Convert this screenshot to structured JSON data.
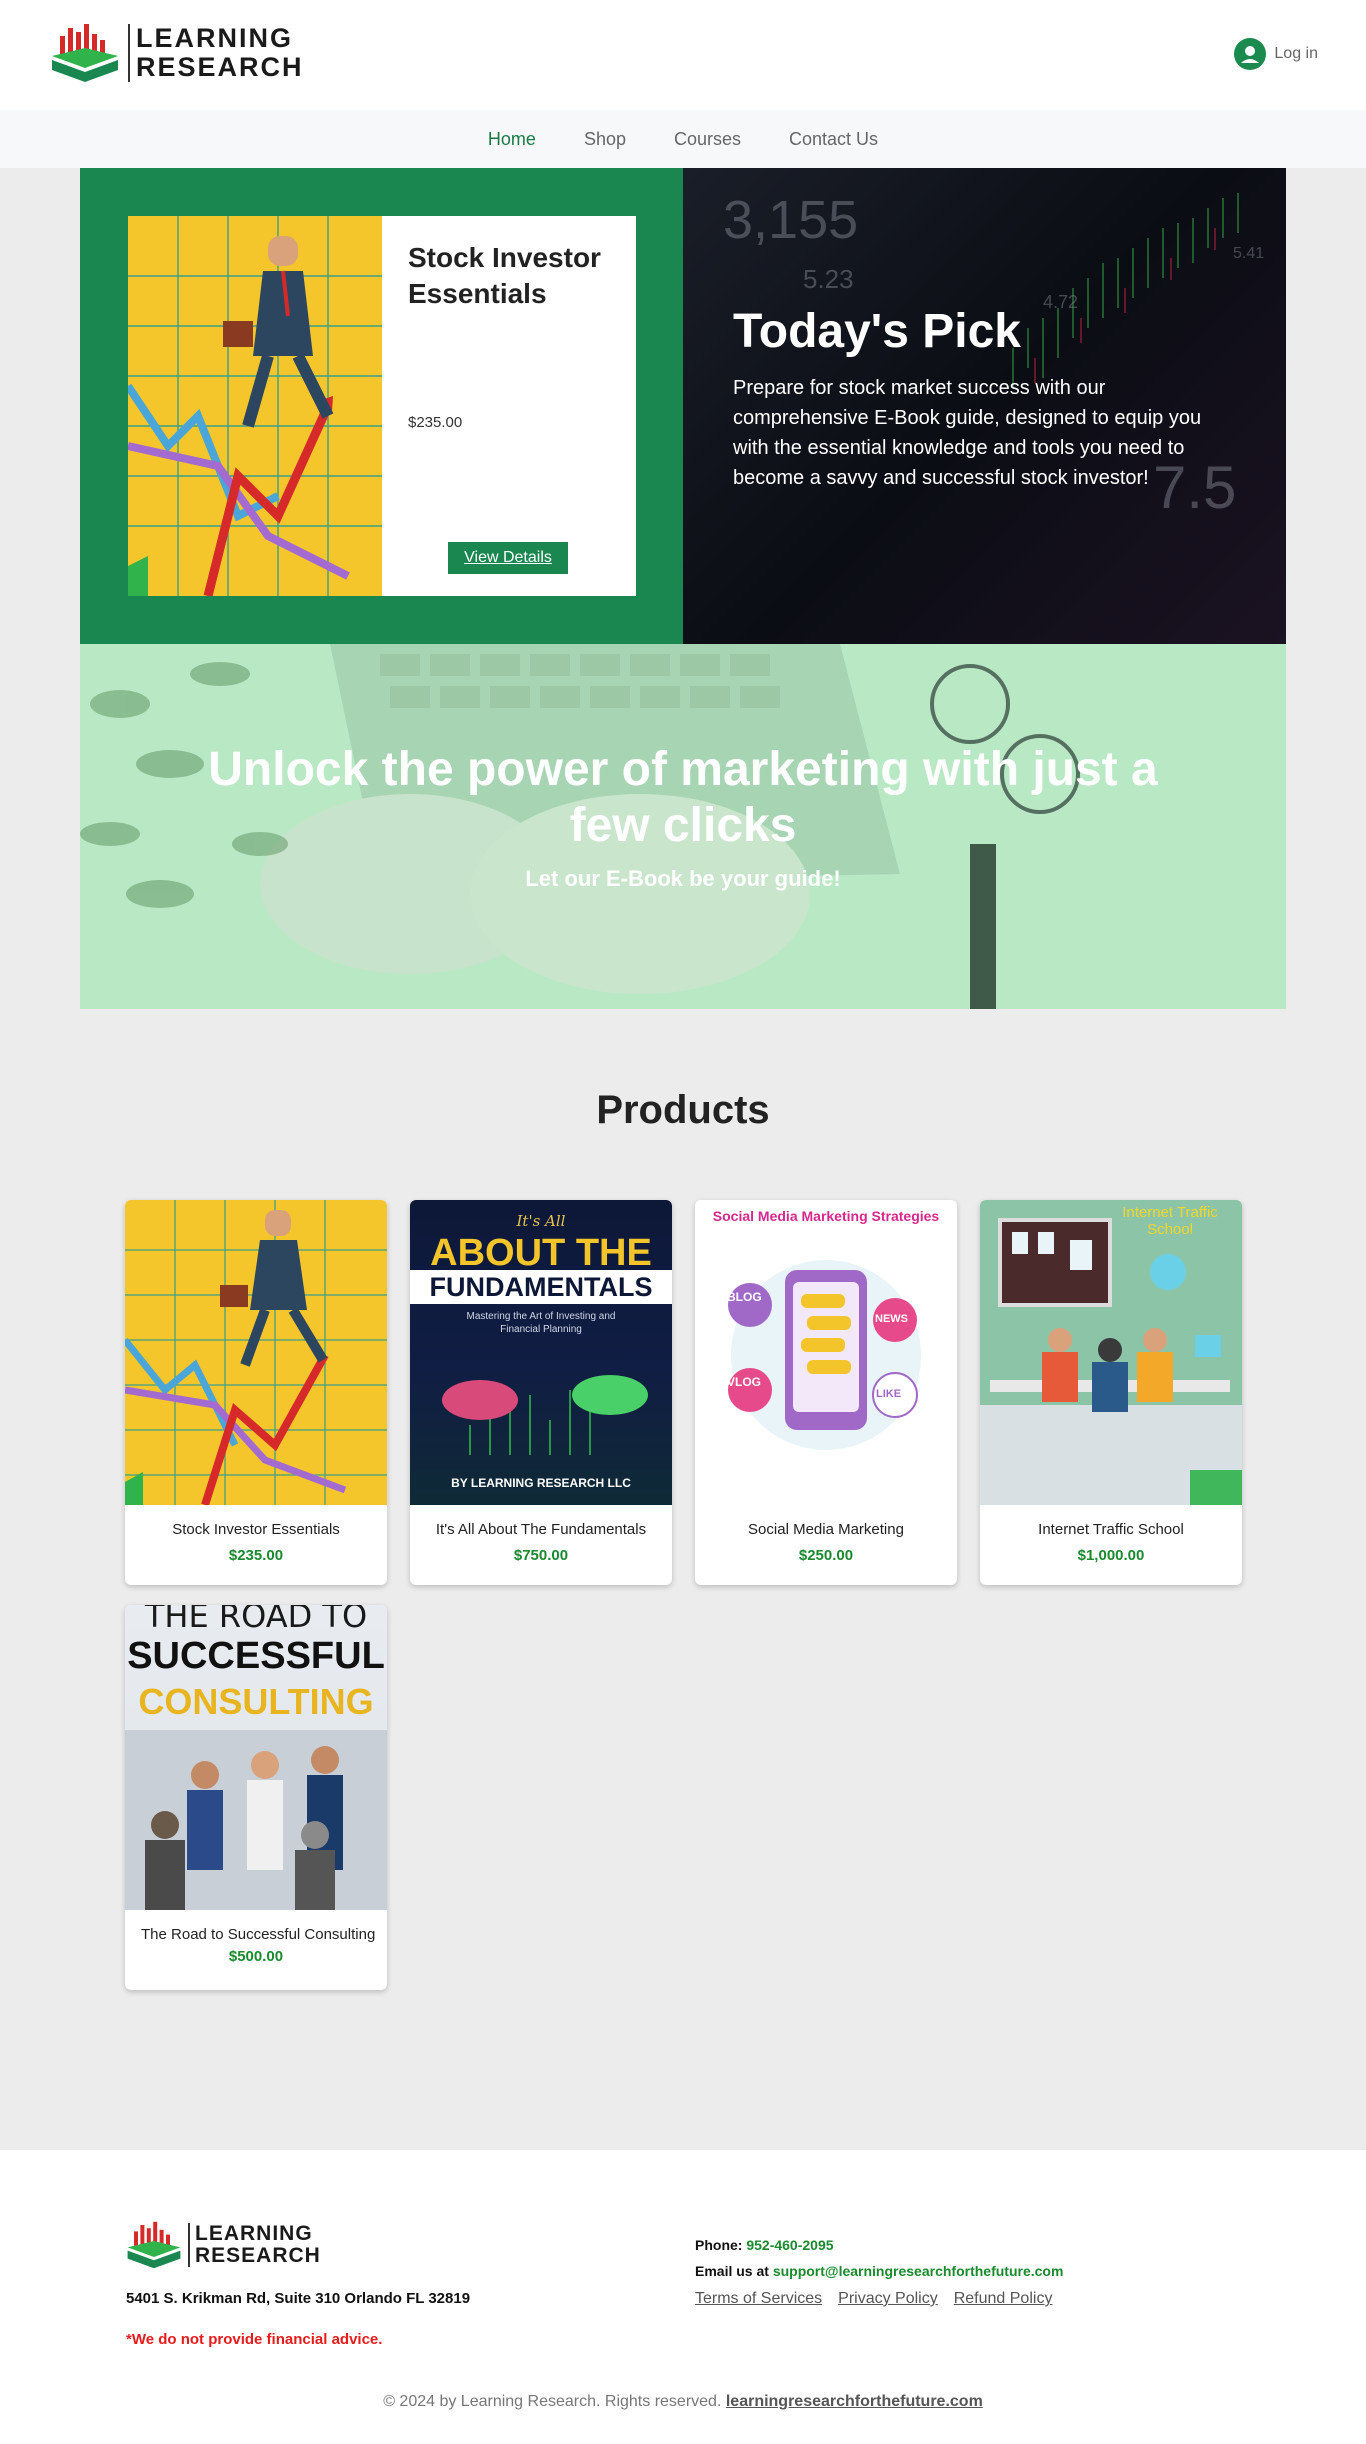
{
  "header": {
    "logo_line1": "LEARNING",
    "logo_line2": "RESEARCH",
    "login_label": "Log in"
  },
  "nav": {
    "items": [
      {
        "label": "Home"
      },
      {
        "label": "Shop"
      },
      {
        "label": "Courses"
      },
      {
        "label": "Contact Us"
      }
    ],
    "active": "Home"
  },
  "todays_pick": {
    "product_title": "Stock Investor Essentials",
    "price": "$235.00",
    "button_label": "View Details",
    "heading": "Today's Pick",
    "description": "Prepare for stock market success with our comprehensive E-Book guide, designed to equip you with the essential knowledge and tools you need to become a savvy and successful stock investor!"
  },
  "banner": {
    "title": "Unlock the power of marketing with just a few clicks",
    "subtitle": "Let our E-Book be your guide!"
  },
  "products": {
    "title": "Products",
    "items": [
      {
        "name": "Stock Investor Essentials",
        "price": "$235.00",
        "cover_text": "Stock Investor Essentials"
      },
      {
        "name": "It's All About The Fundamentals",
        "price": "$750.00",
        "cover_top": "It's All",
        "cover_main": "ABOUT THE",
        "cover_main2": "FUNDAMENTALS",
        "cover_sub": "Mastering the Art of Investing and Financial Planning",
        "cover_by": "BY LEARNING RESEARCH LLC"
      },
      {
        "name": "Social Media Marketing",
        "price": "$250.00",
        "cover_text": "Social Media Marketing Strategies",
        "cover_tags": [
          "BLOG",
          "VLOG",
          "NEWS",
          "LIKE"
        ]
      },
      {
        "name": "Internet Traffic School",
        "price": "$1,000.00",
        "cover_text": "Internet Traffic School"
      },
      {
        "name": "The Road to Successful Consulting",
        "price": "$500.00",
        "cover_top": "THE ROAD TO",
        "cover_main": "SUCCESSFUL",
        "cover_main2": "CONSULTING"
      }
    ]
  },
  "footer": {
    "logo_line1": "LEARNING",
    "logo_line2": "RESEARCH",
    "address": "5401 S. Krikman Rd, Suite 310 Orlando FL 32819",
    "disclaimer": "*We do not provide financial advice.",
    "phone_label": "Phone:",
    "phone": "952-460-2095",
    "email_label": "Email us at",
    "email": "support@learningresearchforthefuture.com",
    "links": [
      "Terms of Services",
      "Privacy Policy",
      "Refund Policy"
    ],
    "copyright": "© 2024 by Learning Research. Rights reserved.",
    "site": "learningresearchforthefuture.com"
  },
  "colors": {
    "brand_green": "#1b8750",
    "price_green": "#1b8a2f",
    "disclaimer_red": "#e61c1c"
  }
}
